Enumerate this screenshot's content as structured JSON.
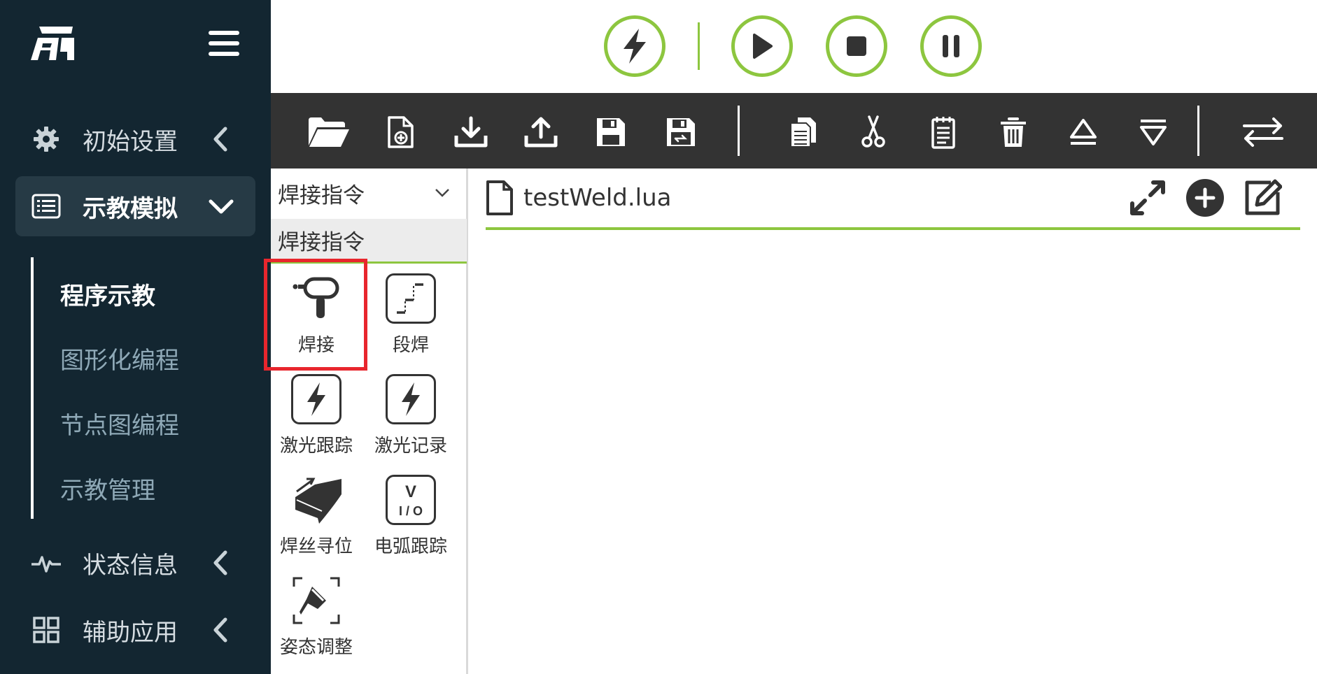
{
  "sidebar": {
    "menu": [
      {
        "label": "初始设置",
        "icon": "gear-icon"
      },
      {
        "label": "示教模拟",
        "icon": "list-icon"
      },
      {
        "label": "状态信息",
        "icon": "pulse-icon"
      },
      {
        "label": "辅助应用",
        "icon": "grid-icon"
      }
    ],
    "submenu": [
      {
        "label": "程序示教"
      },
      {
        "label": "图形化编程"
      },
      {
        "label": "节点图编程"
      },
      {
        "label": "示教管理"
      }
    ]
  },
  "controls": [
    "enable-icon",
    "play-icon",
    "stop-icon",
    "pause-icon"
  ],
  "toolbar": [
    "open-folder-icon",
    "new-file-icon",
    "download-icon",
    "upload-icon",
    "save-icon",
    "save-as-icon",
    "copy-icon",
    "cut-icon",
    "paste-icon",
    "delete-icon",
    "move-up-icon",
    "move-down-icon",
    "swap-icon"
  ],
  "command_panel": {
    "category_selected": "焊接指令",
    "category_header": "焊接指令",
    "commands": [
      {
        "label": "焊接"
      },
      {
        "label": "段焊"
      },
      {
        "label": "激光跟踪"
      },
      {
        "label": "激光记录"
      },
      {
        "label": "焊丝寻位"
      },
      {
        "label": "电弧跟踪"
      },
      {
        "label": "姿态调整"
      }
    ],
    "io_icon_text": {
      "v": "V",
      "io": "I / O"
    }
  },
  "editor": {
    "file_name": "testWeld.lua"
  },
  "colors": {
    "sidebar_bg": "#132631",
    "accent_green": "#8dc63f",
    "toolbar_bg": "#333333",
    "highlight_red": "#e8262d"
  }
}
